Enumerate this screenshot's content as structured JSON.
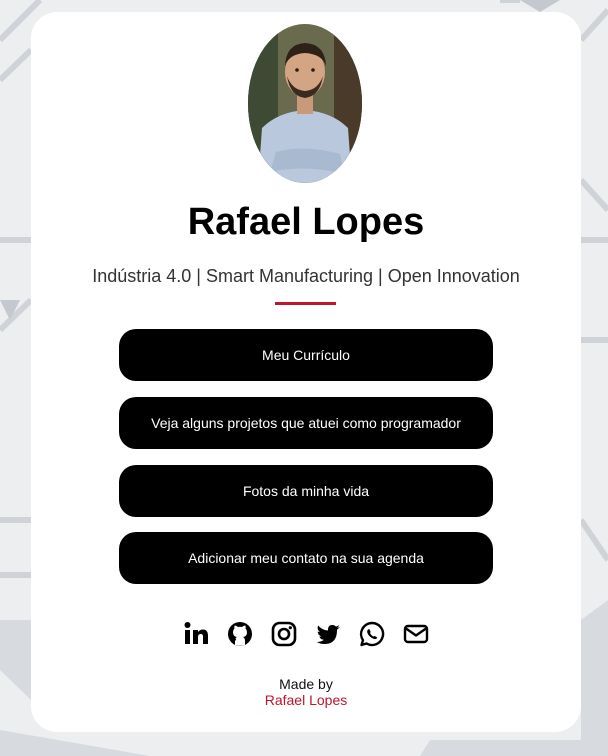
{
  "profile": {
    "name": "Rafael Lopes",
    "subtitle": "Indústria 4.0 | Smart Manufacturing | Open Innovation",
    "avatar_alt": "Rafael Lopes"
  },
  "links": [
    {
      "label": "Meu Currículo"
    },
    {
      "label": "Veja alguns projetos que atuei como programador"
    },
    {
      "label": "Fotos da minha vida"
    },
    {
      "label": "Adicionar meu contato na sua agenda"
    }
  ],
  "socials": [
    {
      "icon": "linkedin-icon"
    },
    {
      "icon": "github-icon"
    },
    {
      "icon": "instagram-icon"
    },
    {
      "icon": "twitter-icon"
    },
    {
      "icon": "whatsapp-icon"
    },
    {
      "icon": "email-icon"
    }
  ],
  "footer": {
    "made_by": "Made by",
    "author": "Rafael Lopes"
  },
  "colors": {
    "accent": "#c0152b",
    "button": "#000000",
    "button_text": "#ffffff",
    "card": "#ffffff",
    "background": "#e9ebed"
  }
}
